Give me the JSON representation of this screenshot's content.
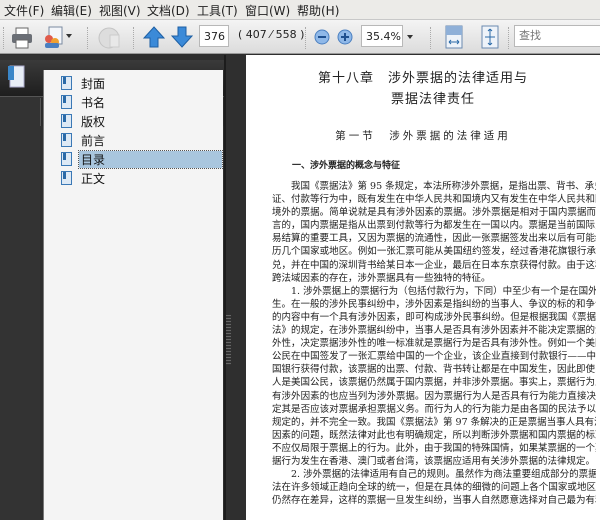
{
  "menu": [
    "文件(F)",
    "编辑(E)",
    "视图(V)",
    "文档(D)",
    "工具(T)",
    "窗口(W)",
    "帮助(H)"
  ],
  "toolbar": {
    "page_input": "376",
    "page_count": "( 407 ⁄ 558 )",
    "zoom_value": "35.4%",
    "search_placeholder": "查找"
  },
  "panel": {
    "title": "书签",
    "bookmarks": [
      {
        "label": "封面"
      },
      {
        "label": "书名"
      },
      {
        "label": "版权"
      },
      {
        "label": "前言"
      },
      {
        "label": "目录",
        "selected": true
      },
      {
        "label": "正文"
      }
    ]
  },
  "document": {
    "chapter_title_1": "第十八章　涉外票据的法律适用与",
    "chapter_title_2": "票据法律责任",
    "section_title": "第一节　涉外票据的法律适用",
    "subheading": "一、涉外票据的概念与特征",
    "paragraphs": [
      [
        "我国《票据法》第 95 条规定，本法所称涉外票据，是指出票、背书、承兑、保",
        "证、付款等行为中，既有发生在中华人民共和国境内又有发生在中华人民共和国",
        "境外的票据。简单说就是具有涉外因素的票据。涉外票据是相对于国内票据而",
        "言的，国内票据是指从出票到付款等行为都发生在一国以内。票据是当前国际贸",
        "易结算的重要工具，又因为票据的流通性，因此一张票据签发出来以后有可能经",
        "历几个国家或地区。例如一张汇票可能从美国纽约签发，经过香港花旗银行承",
        "兑，并在中国的深圳背书给某日本一企业，最后在日本东京获得付款。由于这种",
        "跨法域因素的存在，涉外票据具有一些独特的特征。"
      ],
      [
        "1. 涉外票据上的票据行为（包括付款行为，下同）中至少有一个是在国外发",
        "生。在一般的涉外民事纠纷中，涉外因素是指纠纷的当事人、争议的标的和争议",
        "的内容中有一个具有涉外因素，即可构成涉外民事纠纷。但是根据我国《票据",
        "法》的规定，在涉外票据纠纷中，当事人是否具有涉外因素并不能决定票据的涉",
        "外性，决定票据涉外性的唯一标准就是票据行为是否具有涉外性。例如一个美国",
        "公民在中国签发了一张汇票给中国的一个企业，该企业直接到付款银行——中",
        "国银行获得付款，该票据的出票、付款、背书转让都是在中国发生，因此即使出票",
        "人是美国公民，该票据仍然属于国内票据，并非涉外票据。事实上，票据行为人具",
        "有涉外因素的也应当列为涉外票据。因为票据行为人是否具有行为能力直接决",
        "定其是否应该对票据承担票据义务。而行为人的行为能力是由各国的民法予以",
        "规定的，并不完全一致。我国《票据法》第 97 条解决的正是票据当事人具有涉外",
        "因素的问题，既然法律对此也有明确规定，所以判断涉外票据和国内票据的标准",
        "不应仅局限于票据上的行为。此外，由于我国的特殊国情，如果某票据的一个票",
        "据行为发生在香港、澳门或者台湾，该票据应适用有关涉外票据的法律规定。"
      ],
      [
        "2. 涉外票据的法律适用有自己的规则。虽然作为商法重要组成部分的票据",
        "法在许多领域正趋向全球的统一，但是在具体的细微的问题上各个国家或地区",
        "仍然存在差异，这样的票据一旦发生纠纷，当事人自然愿意选择对自己最为有利"
      ]
    ]
  }
}
